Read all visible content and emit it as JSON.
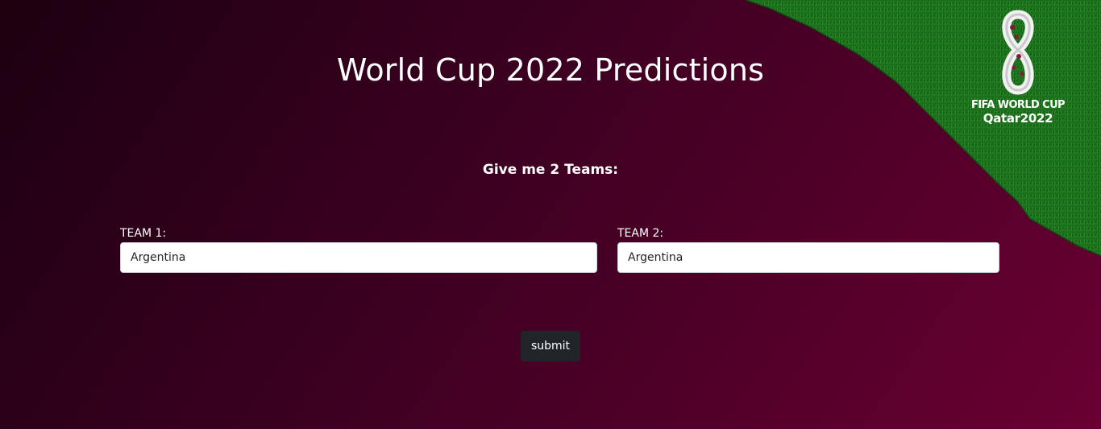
{
  "page": {
    "title": "World Cup 2022 Predictions",
    "subtitle": "Give me 2 Teams:"
  },
  "form": {
    "team1": {
      "label": "TEAM 1:",
      "value": "Argentina"
    },
    "team2": {
      "label": "TEAM 2:",
      "value": "Argentina"
    },
    "submit_label": "submit"
  },
  "logo": {
    "line1": "FIFA WORLD CUP",
    "line2": "Qatar2022"
  },
  "colors": {
    "background_dark": "#1c0010",
    "background_maroon": "#6a0033",
    "grass_green": "#1e7a1e",
    "button_dark": "#212529"
  }
}
